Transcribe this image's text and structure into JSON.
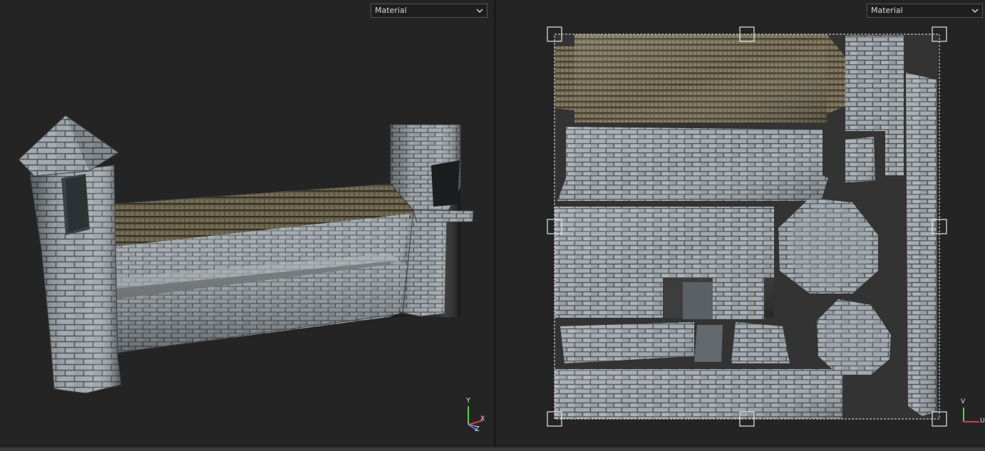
{
  "viewport_3d": {
    "material_select": {
      "value": "Material"
    },
    "axis_gizmo": {
      "x_label": "X",
      "y_label": "Y",
      "z_label": "Z"
    }
  },
  "viewport_uv": {
    "material_select": {
      "value": "Material"
    },
    "axis_gizmo": {
      "v_label": "V",
      "u_label": "U"
    }
  },
  "colors": {
    "background": "#242424",
    "stone": "#8f969c",
    "roof": "#6e6450",
    "x_axis": "#d0403e",
    "y_axis": "#5fce3a",
    "z_axis": "#4a74d4"
  }
}
